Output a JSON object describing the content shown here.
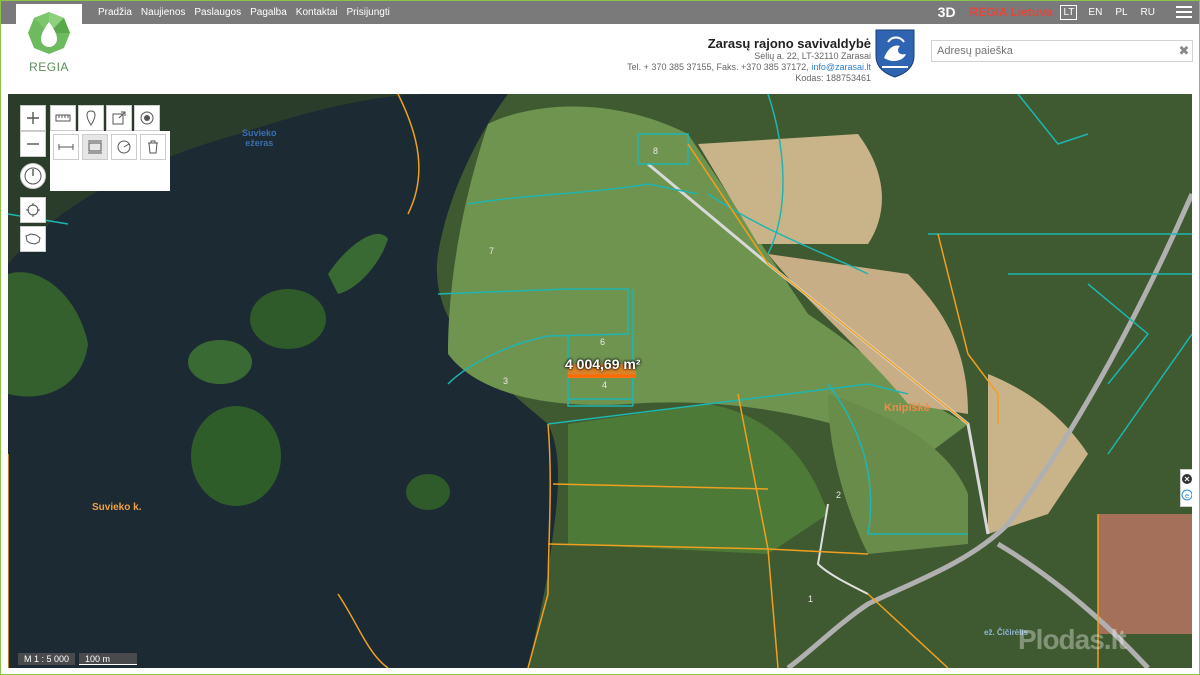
{
  "nav": {
    "items": [
      "Pradžia",
      "Naujienos",
      "Paslaugos",
      "Pagalba",
      "Kontaktai",
      "Prisijungti"
    ]
  },
  "topright": {
    "mode_3d": "3D",
    "brand": "REGIA Lietuva",
    "languages": [
      "LT",
      "EN",
      "PL",
      "RU"
    ],
    "active_language": "LT"
  },
  "logo": {
    "text": "REGIA"
  },
  "municipality": {
    "name": "Zarasų rajono savivaldybė",
    "address": "Sėlių a. 22, LT-32110 Zarasai",
    "phone_prefix": "Tel. + 370 385 37155, Faks. +370 385 37172, ",
    "email": "info@zarasai.lt",
    "code": "Kodas: 188753461"
  },
  "search": {
    "placeholder": "Adresų paieška",
    "value": ""
  },
  "map": {
    "measurement": "4 004,69 m²",
    "labels": {
      "lake_top_line1": "Suvieko",
      "lake_top_line2": "ežeras",
      "lake_main": "Suvieko k.",
      "village": "Knipiškė",
      "bottom_right": "ež. Čičirėlis"
    },
    "parcel_numbers": {
      "p3": "3",
      "p4": "4",
      "p6": "6",
      "p7": "7",
      "p8": "8",
      "p2": "2",
      "p1": "1"
    },
    "scale": {
      "ratio": "M 1 : 5 000",
      "distance": "100 m"
    },
    "watermark": "Plodas.lt"
  },
  "colors": {
    "topbar": "#7a7a7a",
    "brand_red": "#e4473a",
    "parcel_cyan": "#1fb5b0",
    "parcel_orange": "#f0a020",
    "link_blue": "#2f7ec7"
  }
}
